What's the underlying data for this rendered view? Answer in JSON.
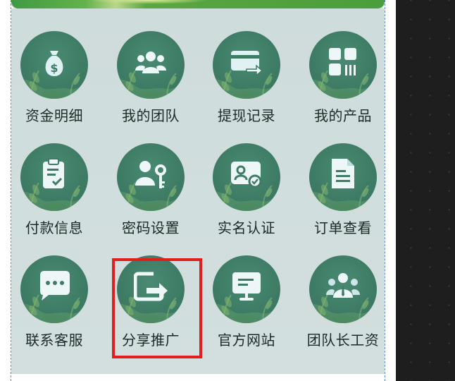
{
  "menu": {
    "items": [
      {
        "label": "资金明细",
        "icon": "money-bag-icon"
      },
      {
        "label": "我的团队",
        "icon": "team-icon"
      },
      {
        "label": "提现记录",
        "icon": "card-transfer-icon"
      },
      {
        "label": "我的产品",
        "icon": "grid-products-icon"
      },
      {
        "label": "付款信息",
        "icon": "clipboard-check-icon"
      },
      {
        "label": "密码设置",
        "icon": "user-key-icon"
      },
      {
        "label": "实名认证",
        "icon": "id-card-verified-icon"
      },
      {
        "label": "订单查看",
        "icon": "document-icon"
      },
      {
        "label": "联系客服",
        "icon": "chat-bubble-icon"
      },
      {
        "label": "分享推广",
        "icon": "share-icon"
      },
      {
        "label": "官方网站",
        "icon": "monitor-icon"
      },
      {
        "label": "团队长工资",
        "icon": "group-leader-icon"
      }
    ]
  },
  "colors": {
    "icon_bg": "#3e7c66",
    "panel_bg": "#d0dddd",
    "highlight": "#e11d1d",
    "banner": "#4a9e3c"
  }
}
